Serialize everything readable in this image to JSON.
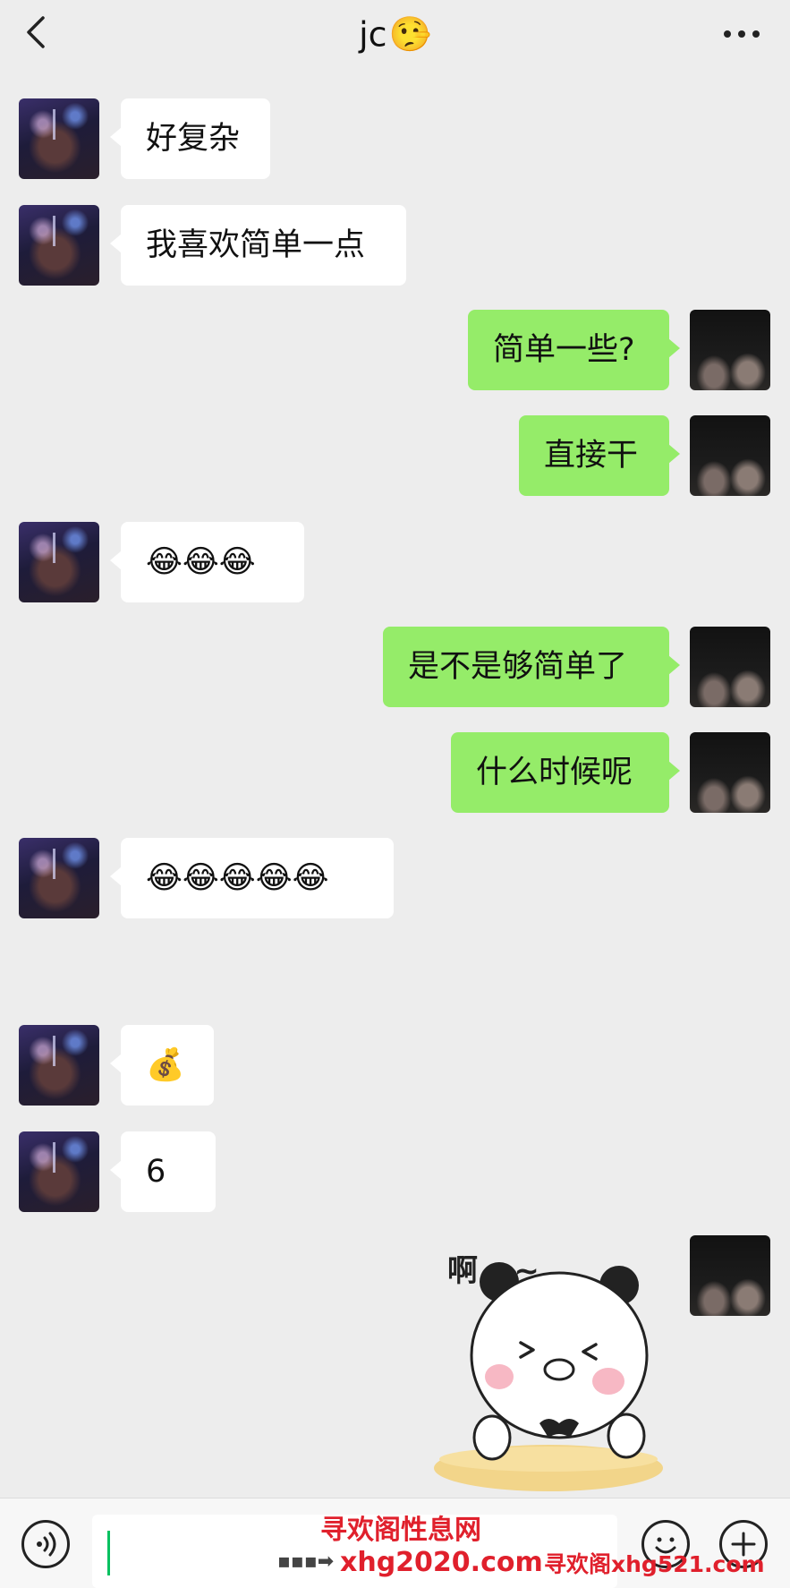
{
  "header": {
    "title": "jc",
    "title_emoji": "🤥",
    "back_icon": "chevron-left-icon",
    "more_icon": "more-dots-icon"
  },
  "messages": [
    {
      "side": "left",
      "text": "好复杂"
    },
    {
      "side": "left",
      "text": "我喜欢简单一点"
    },
    {
      "side": "right",
      "text": "简单一些?"
    },
    {
      "side": "right",
      "text": "直接干"
    },
    {
      "side": "left",
      "text": "😂😂😂"
    },
    {
      "side": "right",
      "text": "是不是够简单了"
    },
    {
      "side": "right",
      "text": "什么时候呢"
    },
    {
      "side": "left",
      "text": "😂😂😂😂😂"
    },
    {
      "side": "left",
      "text": "💰"
    },
    {
      "side": "left",
      "text": "6"
    }
  ],
  "sticker": {
    "text": "啊 ~~",
    "icon": "panda-sticker-icon"
  },
  "input_bar": {
    "value": "",
    "voice_icon": "voice-icon",
    "emoji_icon": "emoji-icon",
    "plus_icon": "plus-icon"
  },
  "watermarks": {
    "line1": "寻欢阁性息网",
    "line2": "xhg2020.com",
    "line3": "寻欢阁xhg521.com"
  },
  "colors": {
    "background": "#ededed",
    "sent_bubble": "#95ec69",
    "received_bubble": "#ffffff",
    "watermark": "#e0202c"
  }
}
